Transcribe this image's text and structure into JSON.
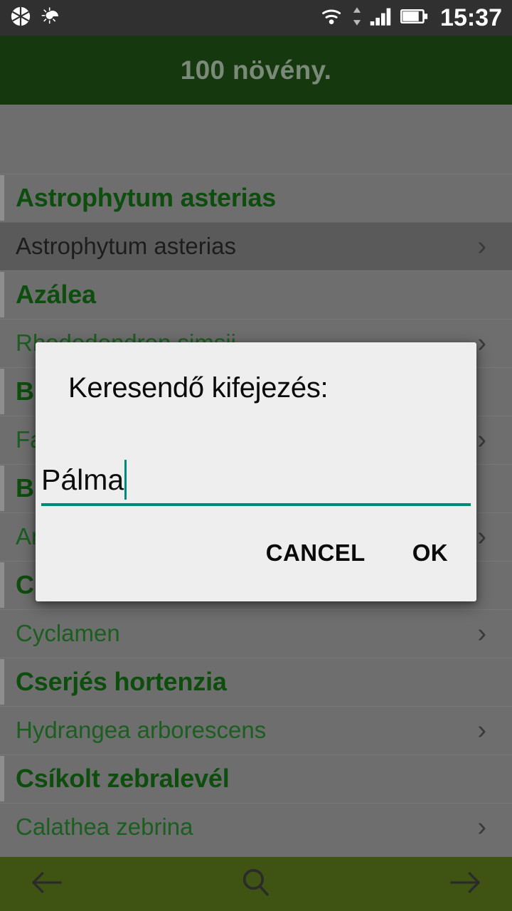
{
  "statusbar": {
    "time": "15:37",
    "left_icons": [
      {
        "name": "camera-aperture-icon"
      },
      {
        "name": "weather-sun-cloud-icon"
      }
    ],
    "right_icons": [
      {
        "name": "wifi-icon"
      },
      {
        "name": "data-transfer-arrows-icon"
      },
      {
        "name": "cellular-signal-icon"
      },
      {
        "name": "battery-icon"
      }
    ],
    "background_color": "#303030",
    "text_color": "#ffffff"
  },
  "appbar": {
    "title": "100 növény.",
    "background_color": "#16380f",
    "title_color": "#7b8a78"
  },
  "list": {
    "rows": [
      {
        "type": "header",
        "label": "Astrophytum asterias"
      },
      {
        "type": "sub",
        "label": "Astrophytum asterias",
        "pressed": true
      },
      {
        "type": "header",
        "label": "Azálea"
      },
      {
        "type": "sub",
        "label": "Rhododendron simsii",
        "pressed": false
      },
      {
        "type": "header",
        "label": "B",
        "truncated": true
      },
      {
        "type": "sub",
        "label": "Fa",
        "truncated": true,
        "pressed": false
      },
      {
        "type": "header",
        "label": "B",
        "truncated": true
      },
      {
        "type": "sub",
        "label": "An",
        "truncated": true,
        "pressed": false
      },
      {
        "type": "header",
        "label": "C",
        "truncated": true
      },
      {
        "type": "sub",
        "label": "Cyclamen",
        "pressed": false
      },
      {
        "type": "header",
        "label": "Cserjés hortenzia"
      },
      {
        "type": "sub",
        "label": "Hydrangea arborescens",
        "pressed": false
      },
      {
        "type": "header",
        "label": "Csíkolt zebralevél"
      },
      {
        "type": "sub",
        "label": "Calathea zebrina",
        "pressed": false
      }
    ],
    "chevron_glyph": "›",
    "header_text_color": "#0d4d0d",
    "sub_text_color": "#1b5e20",
    "background_color": "#6e6e6e"
  },
  "dialog": {
    "title": "Keresendő kifejezés:",
    "input": {
      "value": "Pálma",
      "placeholder": "",
      "accent_color": "#00897b"
    },
    "buttons": {
      "cancel": "CANCEL",
      "ok": "OK"
    },
    "background_color": "#eeeeee"
  },
  "bottombar": {
    "background_color": "#3f5412",
    "buttons": [
      {
        "name": "back-arrow-icon",
        "label": ""
      },
      {
        "name": "search-icon",
        "label": ""
      },
      {
        "name": "forward-arrow-icon",
        "label": ""
      }
    ]
  }
}
